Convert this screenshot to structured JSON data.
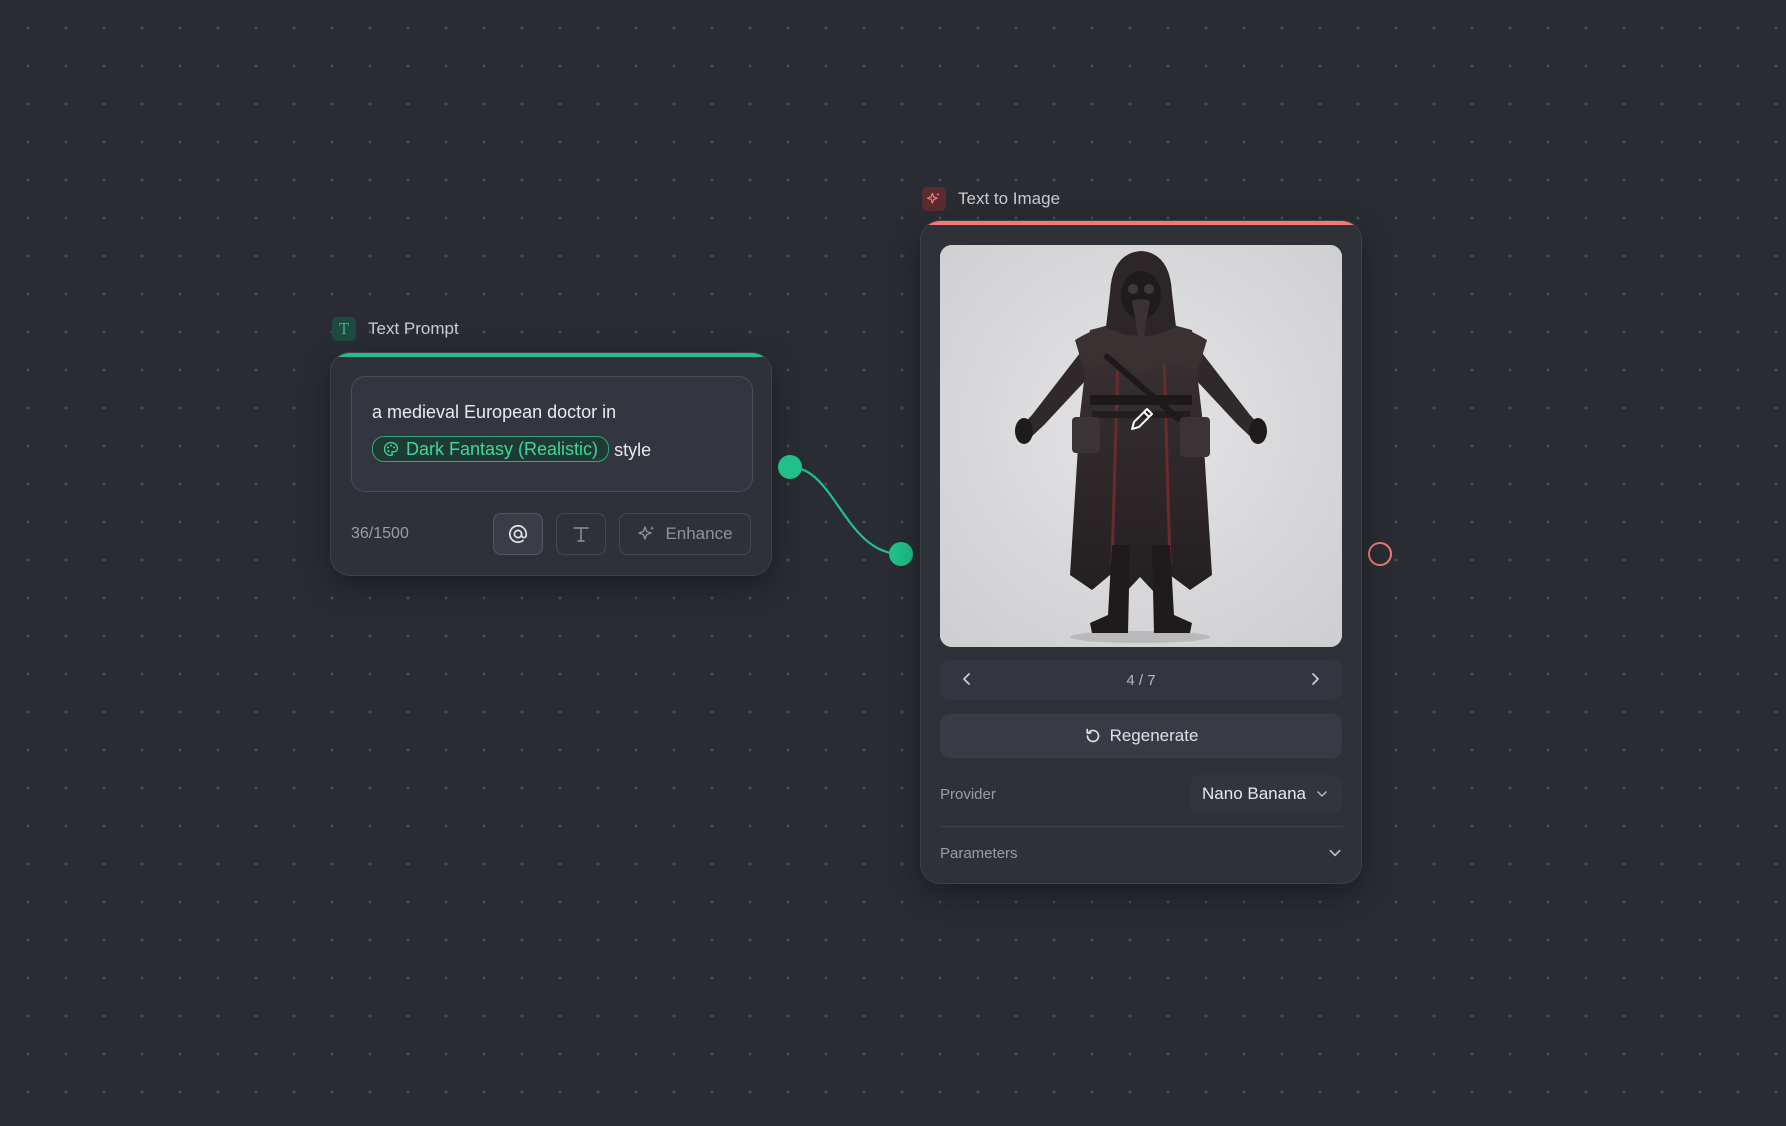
{
  "prompt_node": {
    "title": "Text Prompt",
    "text_before": "a medieval European doctor in",
    "style_chip": "Dark Fantasy (Realistic)",
    "text_after": "style",
    "counter": "36/1500",
    "enhance_label": "Enhance",
    "icons": [
      "text-t-icon",
      "palette-icon",
      "at-sign-icon",
      "text-format-icon",
      "sparkles-icon"
    ]
  },
  "image_node": {
    "title": "Text to Image",
    "image_alt": "Plague doctor character in dark leather coat with beaked mask",
    "pager": "4 / 7",
    "regenerate_label": "Regenerate",
    "provider_label": "Provider",
    "provider_value": "Nano Banana",
    "parameters_label": "Parameters",
    "icons": [
      "sparkles-icon",
      "edit-pencil-icon",
      "chevron-left-icon",
      "chevron-right-icon",
      "refresh-icon",
      "chevron-down-icon"
    ]
  },
  "colors": {
    "canvas": "#2a2c33",
    "prompt_accent": "#21c08b",
    "image_accent": "#f07b74"
  }
}
